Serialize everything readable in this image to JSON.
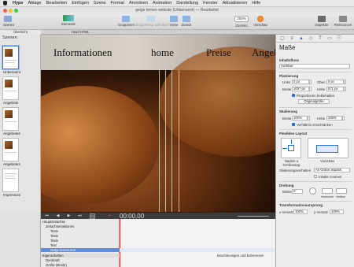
{
  "menubar": {
    "app": "Hype",
    "items": [
      "Ablage",
      "Bearbeiten",
      "Einfügen",
      "Szene",
      "Format",
      "Anordnen",
      "Animation",
      "Darstellung",
      "Fenster",
      "Aktualisieren",
      "Hilfe"
    ]
  },
  "window": {
    "title": "geige lernen website (Unbenannt) — Bearbeitet"
  },
  "toolbar": {
    "scenes": "Szenen",
    "elements": "Elemente",
    "group": "Gruppieren",
    "ungroup": "Gruppierung aufheben",
    "front": "Vorne",
    "back": "Zurück",
    "zoom_value": "200%",
    "zoom": "Zoomen",
    "preview": "Vorschau",
    "inspector": "Inspektor",
    "resources": "Ressourcen"
  },
  "tabs": {
    "overview": "Übersicht",
    "head_html": "Head HTML"
  },
  "scenes": {
    "header": "Szenen",
    "items": [
      {
        "label": "Unbenannt"
      },
      {
        "label": "Angebote"
      },
      {
        "label": "Angebote2"
      },
      {
        "label": "Angebote3"
      },
      {
        "label": "Impressum"
      }
    ]
  },
  "stage": {
    "nav": [
      "Informationen",
      "home",
      "Preise",
      "Angebote"
    ]
  },
  "inspector": {
    "title": "Maße",
    "content_flow": "Inhaltsfluss",
    "content_flow_value": "Sichtbar",
    "placement": "Platzierung",
    "left": "Links",
    "left_value": "0 px",
    "top": "Oben",
    "top_value": "0 px",
    "width": "Breite",
    "width_value": "1007 px",
    "height": "Höhe",
    "height_value": "671 px",
    "keep_proportions": "Proportionen beibehalten",
    "original_size": "Originalgröße",
    "scaling": "Skalierung",
    "scale_width": "Breite",
    "scale_width_value": "100%",
    "scale_height": "Höhe",
    "scale_height_value": "100%",
    "scale_proportional": "Verhältnis einschränken",
    "flexible_layout": "Flexibles Layout",
    "anchor": "Nadeln u. Größenanp.",
    "preview": "Vorschau",
    "scaling_mode": "Skalierungsverhalten",
    "scaling_mode_value": "An Größe anpass.",
    "scale_content": "Inhalte zoomen",
    "rotation": "Drehung",
    "angle": "Winkel",
    "angle_value": "0°",
    "flip_h": "Horizontal",
    "flip_v": "Vertikal",
    "transform_origin": "Transformationsursprung",
    "x_offset": "x-Versatz",
    "x_offset_value": "100%",
    "y_offset": "y-Versatz",
    "y_offset_value": "100%"
  },
  "timeline": {
    "timecode": "00:00,00",
    "main": "Hauptzeitachse",
    "rows": [
      "Zeitachsenaktionen",
      "Texte",
      "Texte",
      "Texte",
      "Text",
      "Geige lernen.text"
    ],
    "props": [
      "Eigenschaften",
      "Deckkraft",
      "Größe (Breite)"
    ],
    "record": "Beschleunigen und bebremsen"
  }
}
